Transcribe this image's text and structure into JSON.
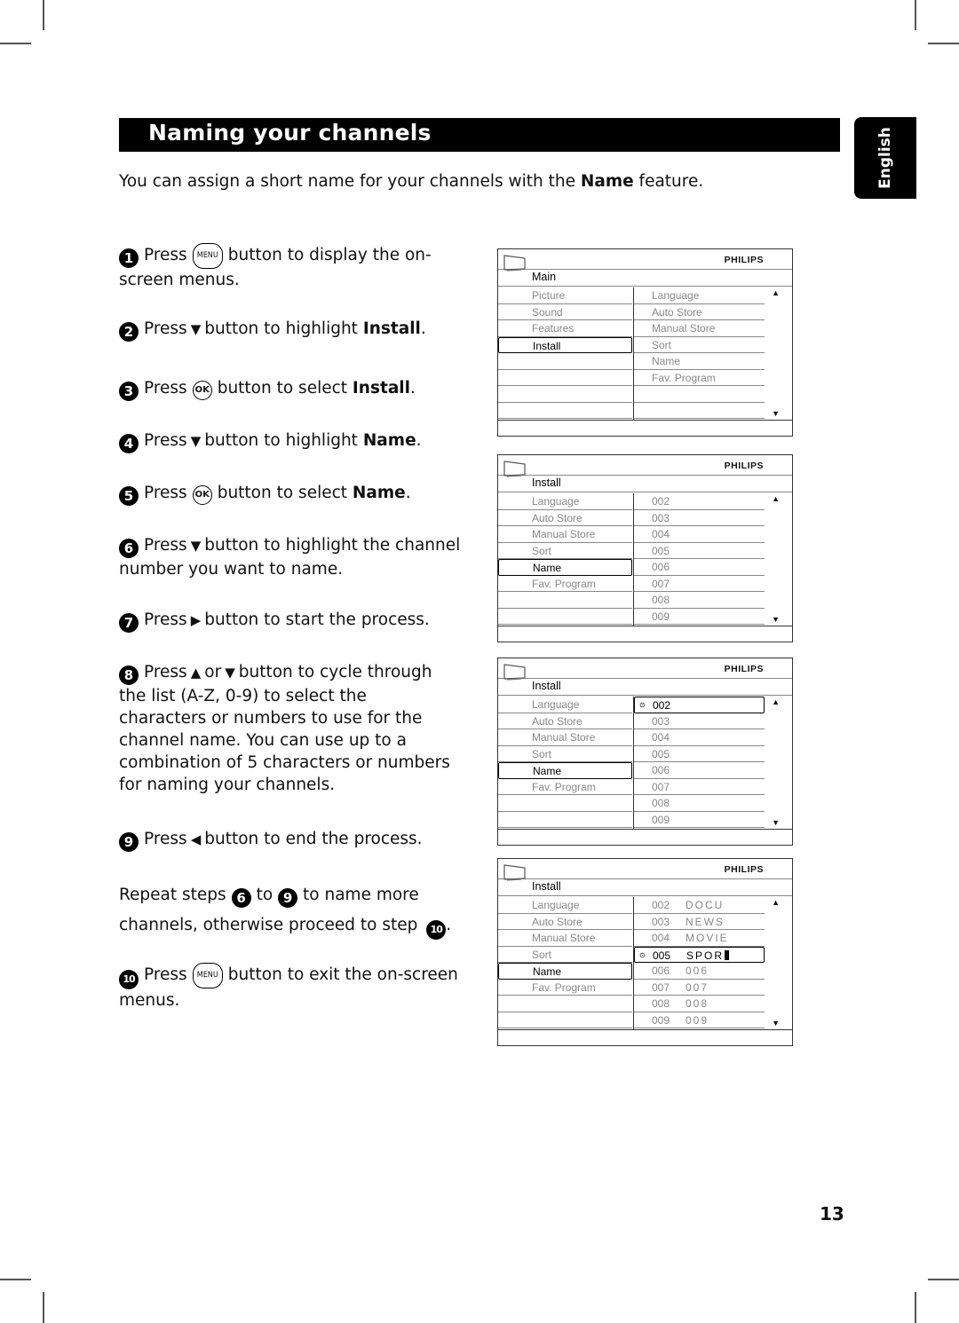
{
  "page": {
    "title": "Naming your channels",
    "language_tab": "English",
    "intro": {
      "before": "You can assign a short name for your channels with the ",
      "bold": "Name",
      "after": " feature."
    },
    "page_number": "13"
  },
  "icons": {
    "menu_button": "MENU",
    "ok_button": "OK"
  },
  "steps": [
    {
      "n": "1",
      "press": "Press",
      "icon": "menu-button",
      "text": "button to display the on-screen menus."
    },
    {
      "n": "2",
      "press": "Press",
      "icon": "down-triangle",
      "text": "button to highlight ",
      "bold": "Install",
      "tail": "."
    },
    {
      "n": "3",
      "press": "Press",
      "icon": "ok-button",
      "text": "button to select ",
      "bold": "Install",
      "tail": "."
    },
    {
      "n": "4",
      "press": "Press",
      "icon": "down-triangle",
      "text": "button to highlight ",
      "bold": "Name",
      "tail": "."
    },
    {
      "n": "5",
      "press": "Press",
      "icon": "ok-button",
      "text": "button to select ",
      "bold": "Name",
      "tail": "."
    },
    {
      "n": "6",
      "press": "Press",
      "icon": "down-triangle",
      "text": "button to highlight the channel number you want to name."
    },
    {
      "n": "7",
      "press": "Press",
      "icon": "right-triangle",
      "text": "button to start the process."
    },
    {
      "n": "8",
      "press": "Press",
      "or": "or",
      "text": "button to cycle through the list (A-Z, 0-9) to select the characters or numbers to use for the channel name. You can use up to a combination of 5 characters or numbers for naming your channels."
    },
    {
      "n": "9",
      "press": "Press",
      "icon": "left-triangle",
      "text": "button to end the process."
    },
    {
      "n": "10",
      "press": "Press",
      "icon": "menu-button",
      "text": "button to exit the on-screen menus."
    }
  ],
  "repeat_note": {
    "a": "Repeat steps",
    "from": "6",
    "b": "to",
    "to": "9",
    "c": "to name more channels, otherwise proceed to step",
    "step": "10",
    "d": "."
  },
  "osd_screens": [
    {
      "brand": "PHILIPS",
      "breadcrumb": "Main",
      "left": [
        "Picture",
        "Sound",
        "Features",
        "Install",
        "",
        "",
        "",
        ""
      ],
      "left_selected": 3,
      "mid": [
        "Language",
        "Auto Store",
        "Manual Store",
        "Sort",
        "Name",
        "Fav. Program",
        "",
        ""
      ],
      "mid_selected": -1
    },
    {
      "brand": "PHILIPS",
      "breadcrumb": "Install",
      "left": [
        "Language",
        "Auto Store",
        "Manual Store",
        "Sort",
        "Name",
        "Fav. Program",
        "",
        ""
      ],
      "left_selected": 4,
      "mid": [
        "002",
        "003",
        "004",
        "005",
        "006",
        "007",
        "008",
        "009"
      ],
      "mid_selected": -1
    },
    {
      "brand": "PHILIPS",
      "breadcrumb": "Install",
      "left": [
        "Language",
        "Auto Store",
        "Manual Store",
        "Sort",
        "Name",
        "Fav. Program",
        "",
        ""
      ],
      "left_selected": 4,
      "mid": [
        "002",
        "003",
        "004",
        "005",
        "006",
        "007",
        "008",
        "009"
      ],
      "mid_selected": 0
    },
    {
      "brand": "PHILIPS",
      "breadcrumb": "Install",
      "left": [
        "Language",
        "Auto Store",
        "Manual Store",
        "Sort",
        "Name",
        "Fav. Program",
        "",
        ""
      ],
      "left_selected": 4,
      "mid": [
        "002",
        "003",
        "004",
        "005",
        "006",
        "007",
        "008",
        "009"
      ],
      "mid_names": [
        "DOCU",
        "NEWS",
        "MOVIE",
        "SPOR",
        "006",
        "007",
        "008",
        "009"
      ],
      "mid_selected": 3,
      "editing_cursor": true
    }
  ]
}
